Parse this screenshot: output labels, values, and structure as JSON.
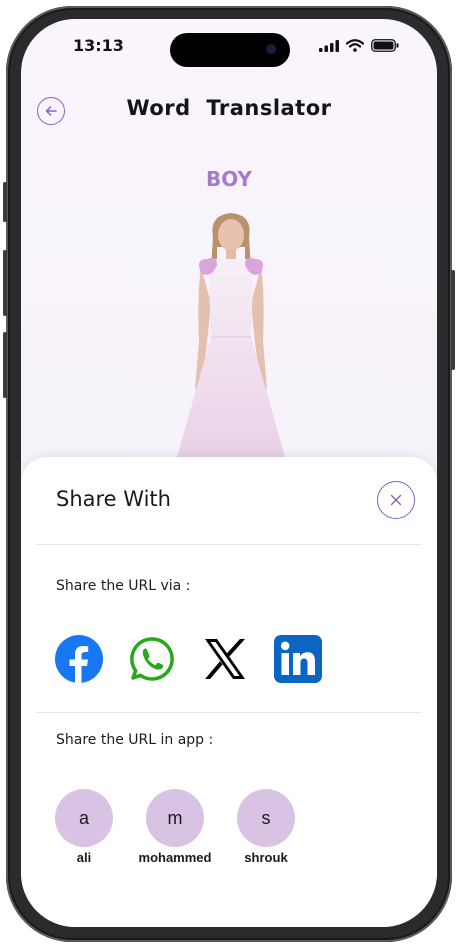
{
  "status_bar": {
    "time": "13:13"
  },
  "header": {
    "title": "Word  Translator"
  },
  "word": {
    "label": "BOY"
  },
  "share_sheet": {
    "title": "Share With",
    "via_label": "Share the URL via :",
    "in_app_label": "Share the URL in app :",
    "social": [
      {
        "name": "facebook",
        "icon": "facebook-icon",
        "color": "#1877f2"
      },
      {
        "name": "whatsapp",
        "icon": "whatsapp-icon",
        "color": "#29a71a"
      },
      {
        "name": "x",
        "icon": "x-icon",
        "color": "#000000"
      },
      {
        "name": "linkedin",
        "icon": "linkedin-icon",
        "color": "#0a66c2"
      }
    ],
    "contacts": [
      {
        "initial": "a",
        "name": "ali"
      },
      {
        "initial": "m",
        "name": "mohammed"
      },
      {
        "initial": "s",
        "name": "shrouk"
      }
    ]
  },
  "colors": {
    "accent": "#8b5fc0",
    "word_label": "#a77bc9",
    "contact_bg": "#d9c3e5"
  }
}
